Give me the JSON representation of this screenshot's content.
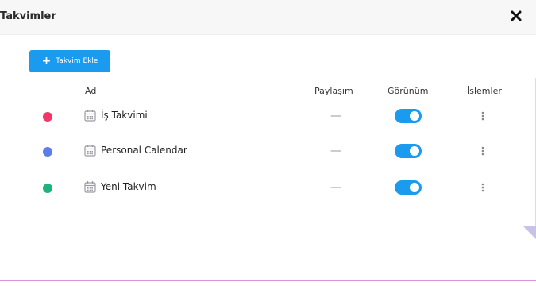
{
  "modal": {
    "title": "Takvimler",
    "add_button_label": "Takvim Ekle"
  },
  "table": {
    "headers": {
      "name": "Ad",
      "sharing": "Paylaşım",
      "visibility": "Görünüm",
      "actions": "İşlemler"
    },
    "rows": [
      {
        "name": "İş Takvimi",
        "color": "#f0386b",
        "sharing": "—",
        "visible": true
      },
      {
        "name": "Personal Calendar",
        "color": "#5b7fe6",
        "sharing": "—",
        "visible": true
      },
      {
        "name": "Yeni Takvim",
        "color": "#1db47c",
        "sharing": "—",
        "visible": true
      }
    ]
  },
  "colors": {
    "accent": "#1a9bf0",
    "icon_gray": "#9a9aa2"
  },
  "icons": {
    "close": "close-icon",
    "add": "plus-icon",
    "calendar": "calendar-icon",
    "actions": "kebab-menu-icon"
  }
}
